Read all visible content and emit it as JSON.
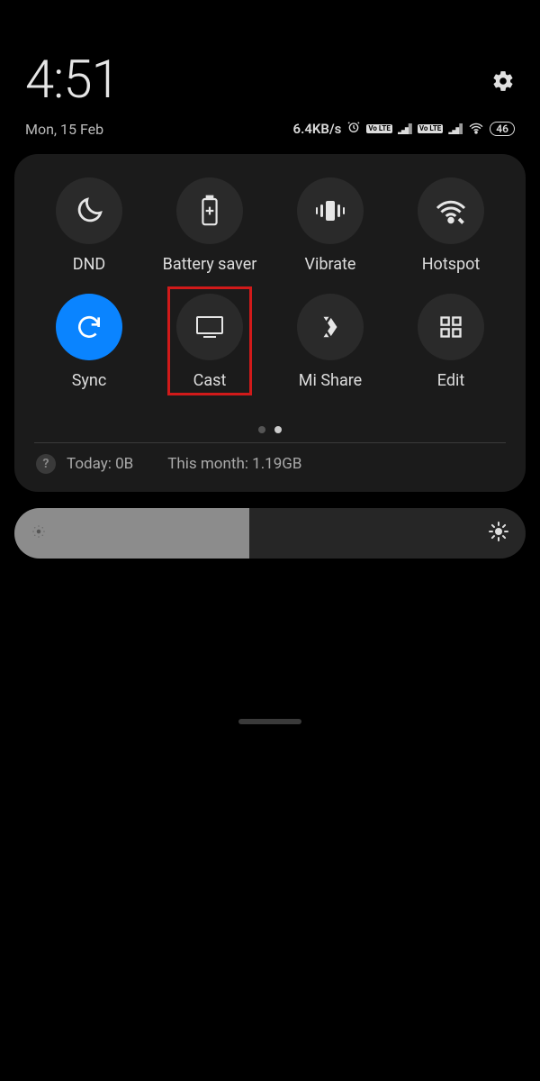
{
  "status": {
    "time": "4:51",
    "date": "Mon, 15 Feb",
    "net_speed": "6.4KB/s",
    "sim1_badge": "Vo LTE",
    "sim2_badge": "Vo LTE",
    "battery_text": "46"
  },
  "tiles": {
    "dnd": "DND",
    "battery_saver": "Battery saver",
    "vibrate": "Vibrate",
    "hotspot": "Hotspot",
    "sync": "Sync",
    "cast": "Cast",
    "mi_share": "Mi Share",
    "edit": "Edit"
  },
  "highlighted_tile": "cast",
  "active_tile": "sync",
  "pagination": {
    "pages": 2,
    "current": 2
  },
  "data_usage": {
    "today_label": "Today: 0B",
    "month_label": "This month: 1.19GB"
  },
  "brightness": {
    "percent": 46
  },
  "colors": {
    "accent": "#0a84ff",
    "highlight_border": "#d11a1a",
    "panel": "#1b1b1b"
  }
}
